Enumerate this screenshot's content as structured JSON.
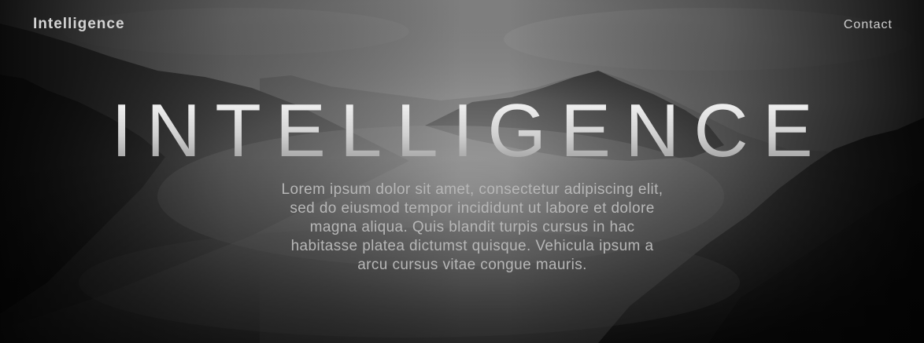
{
  "nav": {
    "brand": "Intelligence",
    "contact_label": "Contact"
  },
  "hero": {
    "title": "INTELLIGENCE",
    "description": "Lorem ipsum dolor sit amet, consectetur adipiscing elit, sed do eiusmod tempor incididunt ut labore et dolore magna aliqua. Quis blandit turpis cursus in hac habitasse platea dictumst quisque. Vehicula ipsum a arcu cursus vitae congue mauris."
  },
  "colors": {
    "sky": "#8a8a8a",
    "fog": "#9c9c9c",
    "forest": "#0e0e0e",
    "nav_text": "#d4d4d4",
    "body_text": "#b7b7b7"
  }
}
